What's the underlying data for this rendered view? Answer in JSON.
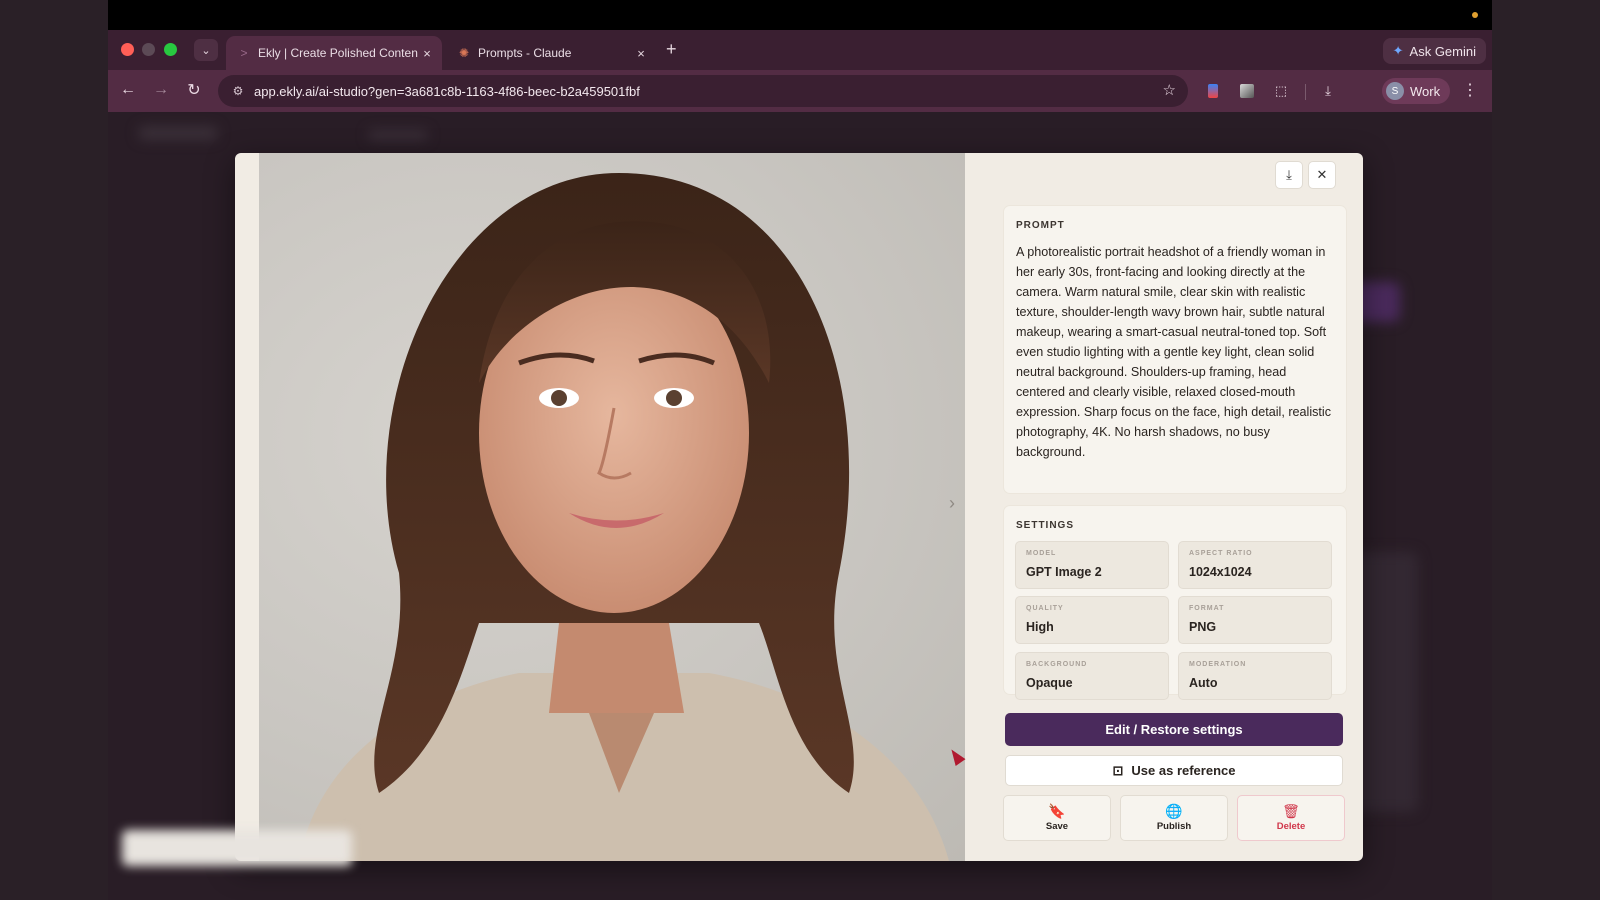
{
  "browser": {
    "tabs": [
      {
        "title": "Ekly | Create Polished Conten",
        "active": true
      },
      {
        "title": "Prompts - Claude",
        "active": false
      }
    ],
    "ask_gemini_label": "Ask Gemini",
    "url": "app.ekly.ai/ai-studio?gen=3a681c8b-1163-4f86-beec-b2a459501fbf",
    "profile": {
      "initial": "S",
      "label": "Work"
    }
  },
  "icons": {
    "tab_menu": "⌄",
    "tab_close": "×",
    "new_tab": "+",
    "back": "←",
    "forward": "→",
    "reload": "↻",
    "site_info": "⚙",
    "star": "☆",
    "extension": "⬚",
    "download": "⤓",
    "more": "⋮",
    "close": "✕",
    "next": "›",
    "reference": "⊡",
    "bookmark": "🔖",
    "globe": "🌐",
    "trash": "🗑",
    "gemini": "✦"
  },
  "modal": {
    "prompt_title": "PROMPT",
    "prompt_text": "A photorealistic portrait headshot of a friendly woman in her early 30s, front-facing and looking directly at the camera. Warm natural smile, clear skin with realistic texture, shoulder-length wavy brown hair, subtle natural makeup, wearing a smart-casual neutral-toned top. Soft even studio lighting with a gentle key light, clean solid neutral background. Shoulders-up framing, head centered and clearly visible, relaxed closed-mouth expression. Sharp focus on the face, high detail, realistic photography, 4K. No harsh shadows, no busy background.",
    "settings_title": "SETTINGS",
    "settings": [
      {
        "label": "MODEL",
        "value": "GPT Image 2"
      },
      {
        "label": "ASPECT RATIO",
        "value": "1024x1024"
      },
      {
        "label": "QUALITY",
        "value": "High"
      },
      {
        "label": "FORMAT",
        "value": "PNG"
      },
      {
        "label": "BACKGROUND",
        "value": "Opaque"
      },
      {
        "label": "MODERATION",
        "value": "Auto"
      }
    ],
    "edit_button": "Edit / Restore settings",
    "reference_button": "Use as reference",
    "actions": {
      "save": "Save",
      "publish": "Publish",
      "delete": "Delete"
    }
  },
  "colors": {
    "primary": "#4a2a5c",
    "delete": "#d0364a",
    "tabbar": "#3a1f31",
    "toolbar": "#532c44"
  }
}
